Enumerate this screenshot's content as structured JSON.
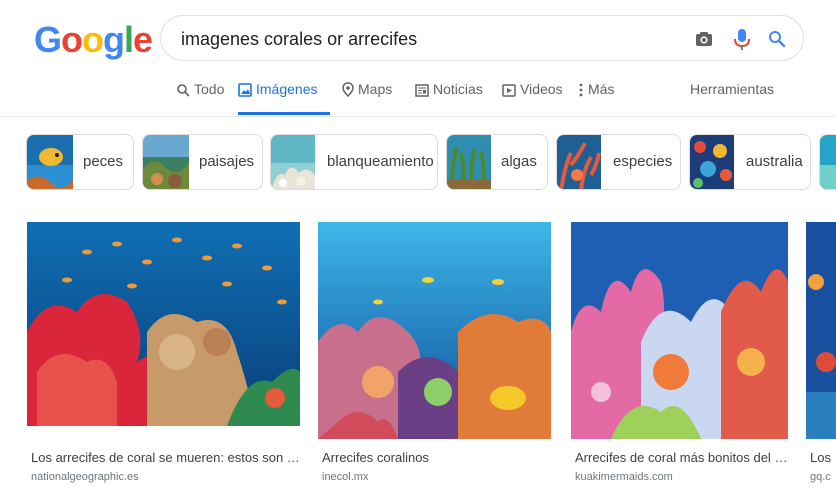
{
  "logo": {
    "letters": [
      "G",
      "o",
      "o",
      "g",
      "l",
      "e"
    ],
    "colors": [
      "#4285f4",
      "#ea4335",
      "#fbbc05",
      "#4285f4",
      "#34a853",
      "#ea4335"
    ]
  },
  "search": {
    "query": "imagenes corales or arrecifes"
  },
  "tabs": [
    {
      "label": "Todo",
      "icon": "search-icon"
    },
    {
      "label": "Imágenes",
      "icon": "image-icon",
      "active": true
    },
    {
      "label": "Maps",
      "icon": "map-pin-icon"
    },
    {
      "label": "Noticias",
      "icon": "news-icon"
    },
    {
      "label": "Videos",
      "icon": "video-icon"
    },
    {
      "label": "Más",
      "icon": "more-icon"
    }
  ],
  "tools_label": "Herramientas",
  "chips": [
    {
      "label": "peces"
    },
    {
      "label": "paisajes"
    },
    {
      "label": "blanqueamiento"
    },
    {
      "label": "algas"
    },
    {
      "label": "especies"
    },
    {
      "label": "australia"
    }
  ],
  "results": [
    {
      "title": "Los arrecifes de coral se mueren: estos son los pl...",
      "source": "nationalgeographic.es"
    },
    {
      "title": "Arrecifes coralinos",
      "source": "inecol.mx"
    },
    {
      "title": "Arrecifes de coral más bonitos del plan...",
      "source": "kuakimermaids.com"
    },
    {
      "title": "Los",
      "source": "gq.c"
    }
  ],
  "colors": {
    "accent": "#1a73e8",
    "mic_blue": "#4285f4",
    "mic_red": "#ea4335"
  }
}
